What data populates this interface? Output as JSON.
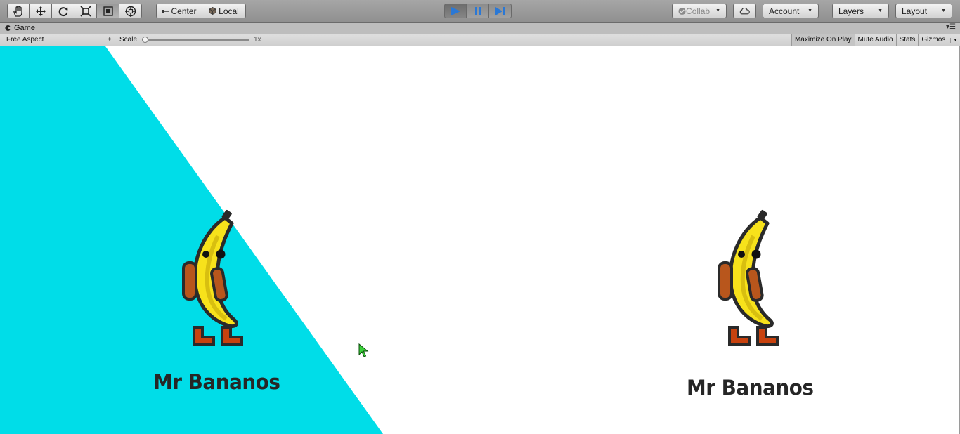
{
  "toolbar": {
    "tools": [
      {
        "name": "hand-tool",
        "icon": "hand-icon"
      },
      {
        "name": "move-tool",
        "icon": "move-arrows-icon"
      },
      {
        "name": "rotate-tool",
        "icon": "rotate-icon"
      },
      {
        "name": "scale-tool",
        "icon": "scale-icon"
      },
      {
        "name": "rect-tool",
        "icon": "rect-transform-icon"
      },
      {
        "name": "transform-tool",
        "icon": "transform-icon"
      }
    ],
    "pivot_label": "Center",
    "space_label": "Local",
    "play_controls": {
      "play_icon": "play-icon",
      "pause_icon": "pause-icon",
      "step_icon": "step-icon"
    },
    "collab_label": "Collab",
    "cloud_icon": "cloud-icon",
    "account_label": "Account",
    "layers_label": "Layers",
    "layout_label": "Layout"
  },
  "tab": {
    "title": "Game",
    "icon": "game-controller-icon",
    "menu_icon": "context-menu-icon"
  },
  "game_controls": {
    "aspect": "Free Aspect",
    "scale_label": "Scale",
    "scale_value": "1x",
    "scale_fraction": 0.0,
    "maximize_on_play": "Maximize On Play",
    "mute_audio": "Mute Audio",
    "stats": "Stats",
    "gizmos": "Gizmos"
  },
  "game_view": {
    "background": "#ffffff",
    "accent": "#00dde8",
    "logos": [
      {
        "name": "logo-left",
        "text": "Mr Bananos"
      },
      {
        "name": "logo-right",
        "text": "Mr Bananos"
      }
    ]
  },
  "colors": {
    "play_active": "#2a78d6",
    "banana_yellow": "#f7e21b",
    "boot_orange": "#c8420e",
    "backpack_brown": "#b8561c"
  }
}
